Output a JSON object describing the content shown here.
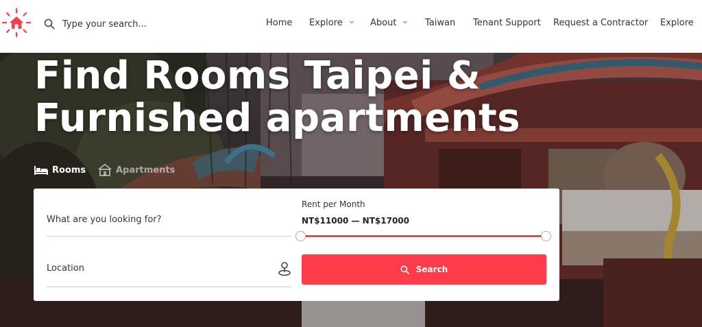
{
  "header": {
    "search": {
      "placeholder": "Type your search..."
    },
    "nav": [
      {
        "label": "Home"
      },
      {
        "label": "Explore",
        "dropdown": true
      },
      {
        "label": "About",
        "dropdown": true
      },
      {
        "label": "Taiwan"
      },
      {
        "label": "Tenant Support"
      },
      {
        "label": "Request a Contractor"
      },
      {
        "label": "Explore"
      }
    ]
  },
  "hero": {
    "title_line1": "Find Rooms Taipei &",
    "title_line2": "Furnished apartments",
    "tabs": [
      {
        "label": "Rooms",
        "icon": "bed-icon",
        "active": true
      },
      {
        "label": "Apartments",
        "icon": "house-icon",
        "active": false
      }
    ]
  },
  "search_form": {
    "what_placeholder": "What are you looking for?",
    "rent_label": "Rent per Month",
    "rent_range": "NT$11000 — NT$17000",
    "rent_min": 11000,
    "rent_max": 17000,
    "location_placeholder": "Location",
    "search_label": "Search"
  },
  "colors": {
    "accent": "#ff3c4a",
    "text": "#333333",
    "header_bg": "#ffffff"
  }
}
